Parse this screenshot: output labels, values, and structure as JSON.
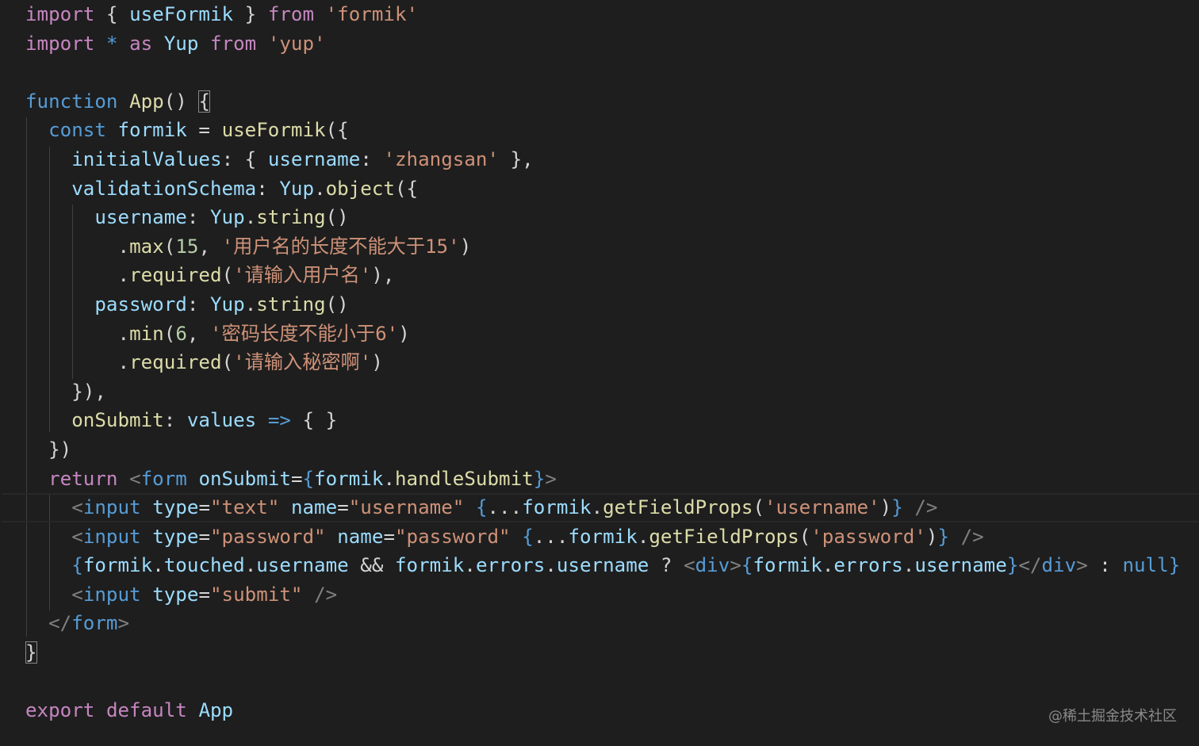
{
  "editor": {
    "language": "javascript",
    "theme": "dark",
    "colors": {
      "background": "#1e1e1e",
      "keyword_control": "#c586c0",
      "keyword": "#569cd6",
      "function": "#dcdcaa",
      "string": "#ce9178",
      "variable": "#9cdcfe",
      "number": "#b5cea8",
      "tag_punctuation": "#808080",
      "plain": "#d4d4d4"
    },
    "lines": [
      [
        [
          "kw-ctrl",
          "import"
        ],
        [
          "plain",
          " { "
        ],
        [
          "var",
          "useFormik"
        ],
        [
          "plain",
          " } "
        ],
        [
          "kw-ctrl",
          "from"
        ],
        [
          "plain",
          " "
        ],
        [
          "str",
          "'formik'"
        ]
      ],
      [
        [
          "kw-ctrl",
          "import"
        ],
        [
          "plain",
          " "
        ],
        [
          "kw",
          "*"
        ],
        [
          "plain",
          " "
        ],
        [
          "kw-ctrl",
          "as"
        ],
        [
          "plain",
          " "
        ],
        [
          "var",
          "Yup"
        ],
        [
          "plain",
          " "
        ],
        [
          "kw-ctrl",
          "from"
        ],
        [
          "plain",
          " "
        ],
        [
          "str",
          "'yup'"
        ]
      ],
      [],
      [
        [
          "kw",
          "function"
        ],
        [
          "plain",
          " "
        ],
        [
          "fn",
          "App"
        ],
        [
          "plain",
          "() "
        ],
        [
          "box",
          "{"
        ]
      ],
      [
        [
          "plain",
          "  "
        ],
        [
          "kw",
          "const"
        ],
        [
          "plain",
          " "
        ],
        [
          "var",
          "formik"
        ],
        [
          "plain",
          " = "
        ],
        [
          "fn",
          "useFormik"
        ],
        [
          "plain",
          "({"
        ]
      ],
      [
        [
          "plain",
          "    "
        ],
        [
          "var",
          "initialValues"
        ],
        [
          "plain",
          ": { "
        ],
        [
          "var",
          "username"
        ],
        [
          "plain",
          ": "
        ],
        [
          "str",
          "'zhangsan'"
        ],
        [
          "plain",
          " },"
        ]
      ],
      [
        [
          "plain",
          "    "
        ],
        [
          "var",
          "validationSchema"
        ],
        [
          "plain",
          ": "
        ],
        [
          "var",
          "Yup"
        ],
        [
          "plain",
          "."
        ],
        [
          "fn",
          "object"
        ],
        [
          "plain",
          "({"
        ]
      ],
      [
        [
          "plain",
          "      "
        ],
        [
          "var",
          "username"
        ],
        [
          "plain",
          ": "
        ],
        [
          "var",
          "Yup"
        ],
        [
          "plain",
          "."
        ],
        [
          "fn",
          "string"
        ],
        [
          "plain",
          "()"
        ]
      ],
      [
        [
          "plain",
          "        ."
        ],
        [
          "fn",
          "max"
        ],
        [
          "plain",
          "("
        ],
        [
          "num",
          "15"
        ],
        [
          "plain",
          ", "
        ],
        [
          "str",
          "'用户名的长度不能大于15'"
        ],
        [
          "plain",
          ")"
        ]
      ],
      [
        [
          "plain",
          "        ."
        ],
        [
          "fn",
          "required"
        ],
        [
          "plain",
          "("
        ],
        [
          "str",
          "'请输入用户名'"
        ],
        [
          "plain",
          "),"
        ]
      ],
      [
        [
          "plain",
          "      "
        ],
        [
          "var",
          "password"
        ],
        [
          "plain",
          ": "
        ],
        [
          "var",
          "Yup"
        ],
        [
          "plain",
          "."
        ],
        [
          "fn",
          "string"
        ],
        [
          "plain",
          "()"
        ]
      ],
      [
        [
          "plain",
          "        ."
        ],
        [
          "fn",
          "min"
        ],
        [
          "plain",
          "("
        ],
        [
          "num",
          "6"
        ],
        [
          "plain",
          ", "
        ],
        [
          "str",
          "'密码长度不能小于6'"
        ],
        [
          "plain",
          ")"
        ]
      ],
      [
        [
          "plain",
          "        ."
        ],
        [
          "fn",
          "required"
        ],
        [
          "plain",
          "("
        ],
        [
          "str",
          "'请输入秘密啊'"
        ],
        [
          "plain",
          ")"
        ]
      ],
      [
        [
          "plain",
          "    }),"
        ]
      ],
      [
        [
          "plain",
          "    "
        ],
        [
          "fn",
          "onSubmit"
        ],
        [
          "plain",
          ": "
        ],
        [
          "param",
          "values"
        ],
        [
          "plain",
          " "
        ],
        [
          "kw",
          "=>"
        ],
        [
          "plain",
          " { }"
        ]
      ],
      [
        [
          "plain",
          "  })"
        ]
      ],
      [
        [
          "plain",
          "  "
        ],
        [
          "kw-ctrl",
          "return"
        ],
        [
          "plain",
          " "
        ],
        [
          "tagp",
          "<"
        ],
        [
          "tag",
          "form"
        ],
        [
          "plain",
          " "
        ],
        [
          "attr",
          "onSubmit"
        ],
        [
          "plain",
          "="
        ],
        [
          "kw",
          "{"
        ],
        [
          "var",
          "formik"
        ],
        [
          "plain",
          "."
        ],
        [
          "fn",
          "handleSubmit"
        ],
        [
          "kw",
          "}"
        ],
        [
          "tagp",
          ">"
        ]
      ],
      [
        [
          "plain",
          "    "
        ],
        [
          "tagp",
          "<"
        ],
        [
          "tag",
          "input"
        ],
        [
          "plain",
          " "
        ],
        [
          "attr",
          "type"
        ],
        [
          "plain",
          "="
        ],
        [
          "str",
          "\"text\""
        ],
        [
          "plain",
          " "
        ],
        [
          "attr",
          "name"
        ],
        [
          "plain",
          "="
        ],
        [
          "str",
          "\"username\""
        ],
        [
          "plain",
          " "
        ],
        [
          "kw",
          "{"
        ],
        [
          "plain",
          "..."
        ],
        [
          "var",
          "formik"
        ],
        [
          "plain",
          "."
        ],
        [
          "fn",
          "getFieldProps"
        ],
        [
          "plain",
          "("
        ],
        [
          "str",
          "'username'"
        ],
        [
          "plain",
          ")"
        ],
        [
          "kw",
          "}"
        ],
        [
          "plain",
          " "
        ],
        [
          "tagp",
          "/>"
        ]
      ],
      [
        [
          "plain",
          "    "
        ],
        [
          "tagp",
          "<"
        ],
        [
          "tag",
          "input"
        ],
        [
          "plain",
          " "
        ],
        [
          "attr",
          "type"
        ],
        [
          "plain",
          "="
        ],
        [
          "str",
          "\"password\""
        ],
        [
          "plain",
          " "
        ],
        [
          "attr",
          "name"
        ],
        [
          "plain",
          "="
        ],
        [
          "str",
          "\"password\""
        ],
        [
          "plain",
          " "
        ],
        [
          "kw",
          "{"
        ],
        [
          "plain",
          "..."
        ],
        [
          "var",
          "formik"
        ],
        [
          "plain",
          "."
        ],
        [
          "fn",
          "getFieldProps"
        ],
        [
          "plain",
          "("
        ],
        [
          "str",
          "'password'"
        ],
        [
          "plain",
          ")"
        ],
        [
          "kw",
          "}"
        ],
        [
          "plain",
          " "
        ],
        [
          "tagp",
          "/>"
        ]
      ],
      [
        [
          "plain",
          "    "
        ],
        [
          "kw",
          "{"
        ],
        [
          "var",
          "formik"
        ],
        [
          "plain",
          "."
        ],
        [
          "var",
          "touched"
        ],
        [
          "plain",
          "."
        ],
        [
          "var",
          "username"
        ],
        [
          "plain",
          " && "
        ],
        [
          "var",
          "formik"
        ],
        [
          "plain",
          "."
        ],
        [
          "var",
          "errors"
        ],
        [
          "plain",
          "."
        ],
        [
          "var",
          "username"
        ],
        [
          "plain",
          " ? "
        ],
        [
          "tagp",
          "<"
        ],
        [
          "tag",
          "div"
        ],
        [
          "tagp",
          ">"
        ],
        [
          "kw",
          "{"
        ],
        [
          "var",
          "formik"
        ],
        [
          "plain",
          "."
        ],
        [
          "var",
          "errors"
        ],
        [
          "plain",
          "."
        ],
        [
          "var",
          "username"
        ],
        [
          "kw",
          "}"
        ],
        [
          "tagp",
          "</"
        ],
        [
          "tag",
          "div"
        ],
        [
          "tagp",
          ">"
        ],
        [
          "plain",
          " : "
        ],
        [
          "kw",
          "null"
        ],
        [
          "kw",
          "}"
        ]
      ],
      [
        [
          "plain",
          "    "
        ],
        [
          "tagp",
          "<"
        ],
        [
          "tag",
          "input"
        ],
        [
          "plain",
          " "
        ],
        [
          "attr",
          "type"
        ],
        [
          "plain",
          "="
        ],
        [
          "str",
          "\"submit\""
        ],
        [
          "plain",
          " "
        ],
        [
          "tagp",
          "/>"
        ]
      ],
      [
        [
          "plain",
          "  "
        ],
        [
          "tagp",
          "</"
        ],
        [
          "tag",
          "form"
        ],
        [
          "tagp",
          ">"
        ]
      ],
      [
        [
          "box",
          "}"
        ]
      ],
      [],
      [
        [
          "kw-ctrl",
          "export"
        ],
        [
          "plain",
          " "
        ],
        [
          "kw-ctrl",
          "default"
        ],
        [
          "plain",
          " "
        ],
        [
          "var",
          "App"
        ]
      ]
    ],
    "current_line": 17
  },
  "watermark": "@稀土掘金技术社区"
}
